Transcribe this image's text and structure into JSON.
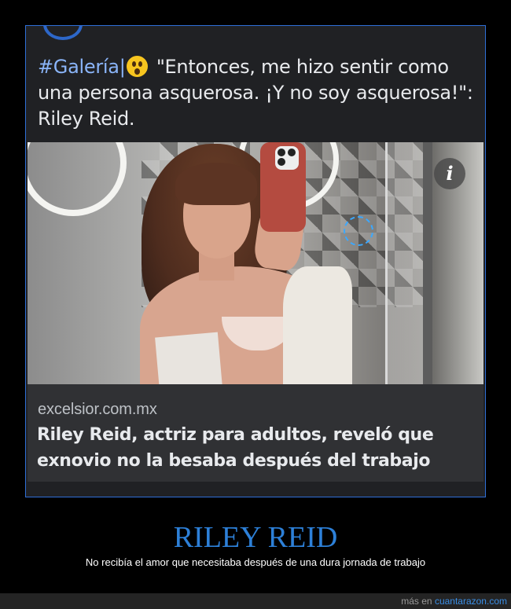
{
  "post": {
    "hashtag": "#Galería|",
    "emoji": "astonished-emoji",
    "text": " \"Entonces, me hizo sentir como una persona asquerosa. ¡Y no soy asquerosa!\": Riley Reid."
  },
  "article": {
    "source_domain": "excelsior.com.mx",
    "headline": "Riley Reid, actriz para adultos, reveló que exnovio no la besaba después del trabajo",
    "info_label": "i"
  },
  "meme": {
    "title": "RILEY REID",
    "caption": "No recibía el amor que necesitaba después de una dura jornada de trabajo"
  },
  "footer": {
    "prefix": "más en ",
    "link": "cuantarazon.com"
  },
  "colors": {
    "accent_blue": "#2d80d8",
    "frame_blue": "#2f6fd8",
    "dark_card": "#303134"
  }
}
